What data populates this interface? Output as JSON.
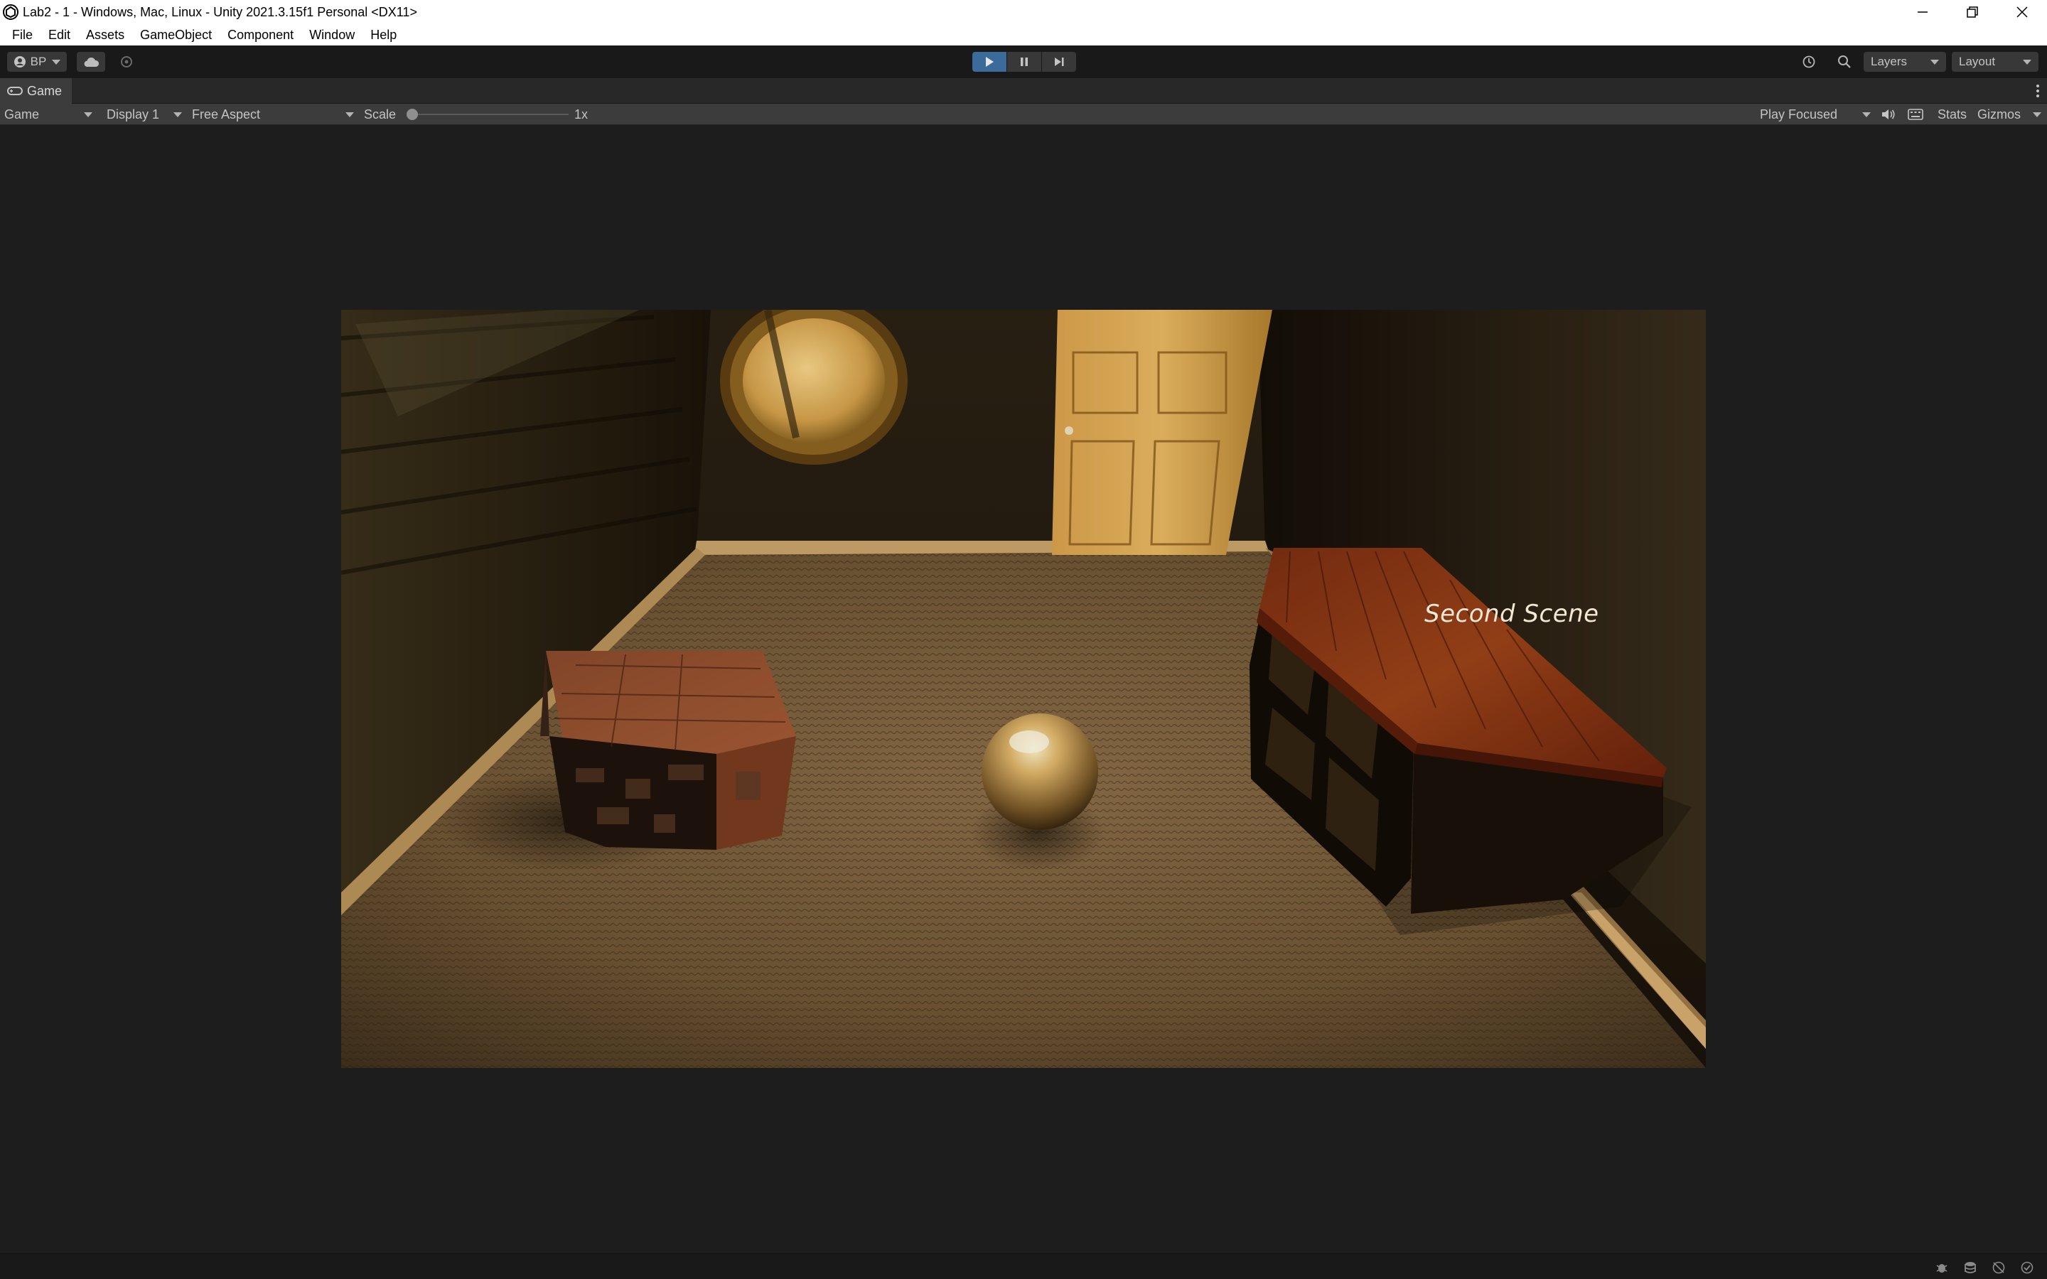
{
  "window": {
    "title": "Lab2 - 1 - Windows, Mac, Linux - Unity 2021.3.15f1 Personal <DX11>"
  },
  "menu": [
    "File",
    "Edit",
    "Assets",
    "GameObject",
    "Component",
    "Window",
    "Help"
  ],
  "toolbar": {
    "account_label": "BP",
    "layers_label": "Layers",
    "layout_label": "Layout",
    "play_state": "playing"
  },
  "panel": {
    "tab_label": "Game"
  },
  "game_toolbar": {
    "view_mode": "Game",
    "display": "Display 1",
    "aspect": "Free Aspect",
    "scale_label": "Scale",
    "scale_value": "1x",
    "play_mode": "Play Focused",
    "stats_label": "Stats",
    "gizmos_label": "Gizmos"
  },
  "scene": {
    "label": "Second Scene"
  },
  "colors": {
    "accent": "#3a6b9a",
    "toolbar_bg": "#191919",
    "panel_bg": "#282828"
  }
}
